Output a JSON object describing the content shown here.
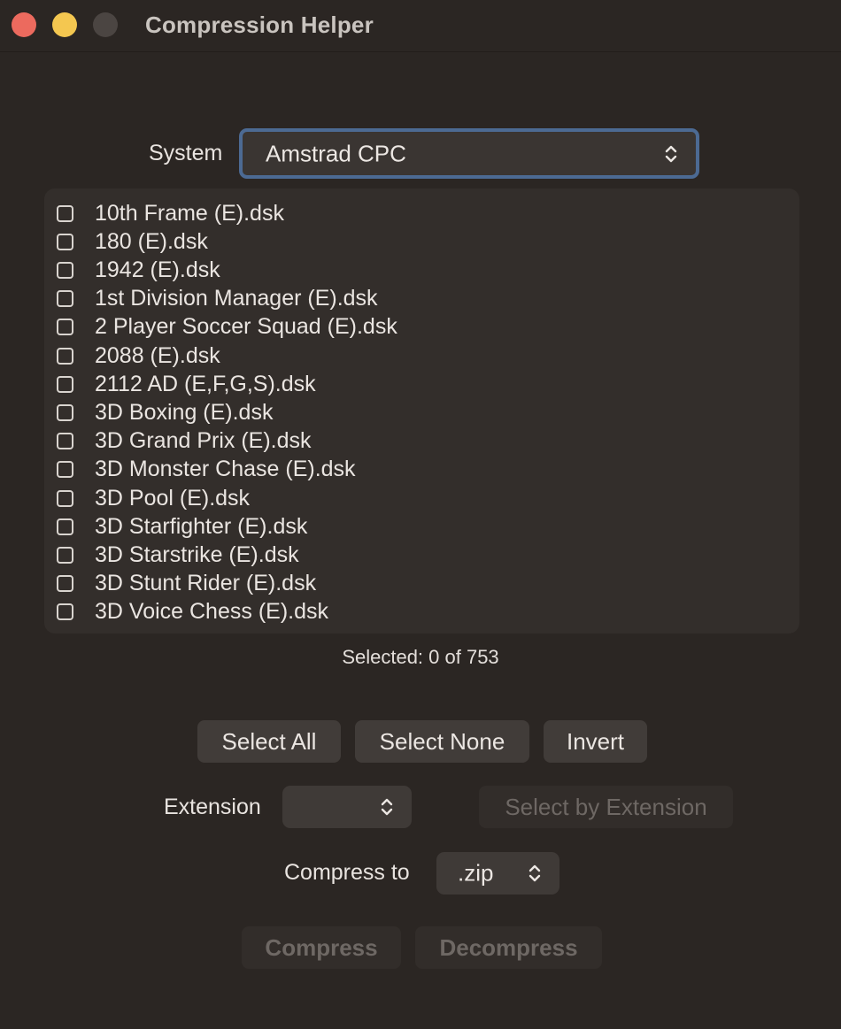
{
  "window": {
    "title": "Compression Helper"
  },
  "system": {
    "label": "System",
    "selected": "Amstrad CPC"
  },
  "files": [
    {
      "name": "10th Frame (E).dsk",
      "checked": false
    },
    {
      "name": "180 (E).dsk",
      "checked": false
    },
    {
      "name": "1942 (E).dsk",
      "checked": false
    },
    {
      "name": "1st Division Manager (E).dsk",
      "checked": false
    },
    {
      "name": "2 Player Soccer Squad (E).dsk",
      "checked": false
    },
    {
      "name": "2088 (E).dsk",
      "checked": false
    },
    {
      "name": "2112 AD (E,F,G,S).dsk",
      "checked": false
    },
    {
      "name": "3D Boxing (E).dsk",
      "checked": false
    },
    {
      "name": "3D Grand Prix (E).dsk",
      "checked": false
    },
    {
      "name": "3D Monster Chase (E).dsk",
      "checked": false
    },
    {
      "name": "3D Pool (E).dsk",
      "checked": false
    },
    {
      "name": "3D Starfighter (E).dsk",
      "checked": false
    },
    {
      "name": "3D Starstrike (E).dsk",
      "checked": false
    },
    {
      "name": "3D Stunt Rider (E).dsk",
      "checked": false
    },
    {
      "name": "3D Voice Chess (E).dsk",
      "checked": false
    }
  ],
  "status": {
    "selected_text": "Selected: 0 of 753"
  },
  "selection_buttons": {
    "select_all": "Select All",
    "select_none": "Select None",
    "invert": "Invert"
  },
  "extension": {
    "label": "Extension",
    "selected": "",
    "select_by_extension": "Select by Extension"
  },
  "compress_to": {
    "label": "Compress to",
    "selected": ".zip"
  },
  "actions": {
    "compress": "Compress",
    "decompress": "Decompress"
  },
  "icons": {
    "popup_chevron": "chevron-up-down-icon"
  }
}
